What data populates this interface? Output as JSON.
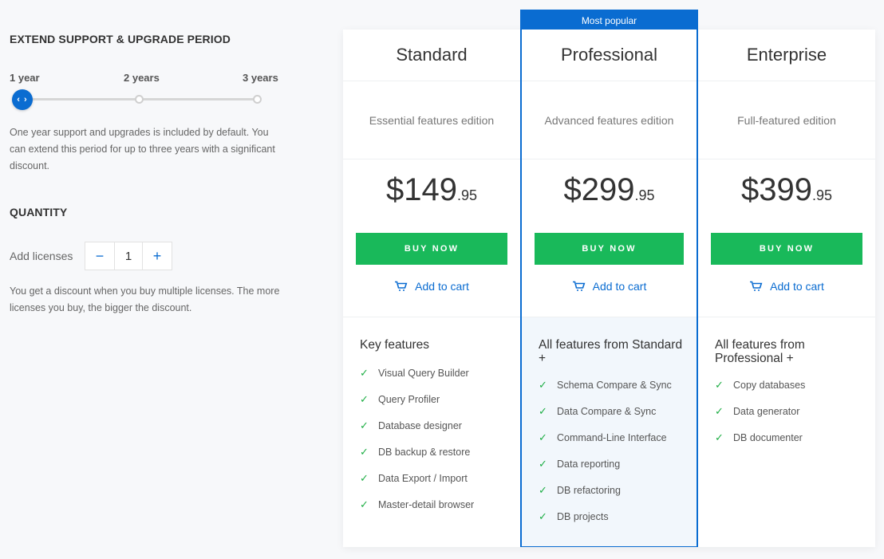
{
  "period": {
    "title": "EXTEND SUPPORT & UPGRADE PERIOD",
    "options": [
      "1 year",
      "2 years",
      "3 years"
    ],
    "selected": "1 year",
    "handle_glyph": "‹ ›",
    "description": "One year support and upgrades is included by default. You can extend this period for up to three years with a significant discount."
  },
  "quantity": {
    "title": "QUANTITY",
    "label": "Add licenses",
    "decrement": "−",
    "value": "1",
    "increment": "+",
    "description": "You get a discount when you buy multiple licenses. The more licenses you buy, the bigger the discount."
  },
  "plans": [
    {
      "name": "Standard",
      "subtitle": "Essential features edition",
      "price_main": "$149",
      "price_cents": ".95",
      "buy_label": "BUY NOW",
      "cart_label": "Add to cart",
      "features_title": "Key features",
      "features": [
        "Visual Query Builder",
        "Query Profiler",
        "Database designer",
        "DB backup & restore",
        "Data Export / Import",
        "Master-detail browser"
      ]
    },
    {
      "badge": "Most popular",
      "name": "Professional",
      "subtitle": "Advanced features edition",
      "price_main": "$299",
      "price_cents": ".95",
      "buy_label": "BUY NOW",
      "cart_label": "Add to cart",
      "features_title": "All features from Standard +",
      "features": [
        "Schema Compare & Sync",
        "Data Compare & Sync",
        "Command-Line Interface",
        "Data reporting",
        "DB refactoring",
        "DB projects"
      ]
    },
    {
      "name": "Enterprise",
      "subtitle": "Full-featured edition",
      "price_main": "$399",
      "price_cents": ".95",
      "buy_label": "BUY NOW",
      "cart_label": "Add to cart",
      "features_title": "All features from Professional +",
      "features": [
        "Copy databases",
        "Data generator",
        "DB documenter"
      ]
    }
  ],
  "colors": {
    "accent": "#0a6cd1",
    "buy": "#19b95a",
    "check": "#1eae45",
    "highlight_bg": "#f2f7fc"
  },
  "icons": {
    "check": "✓",
    "cart": "cart-icon"
  }
}
